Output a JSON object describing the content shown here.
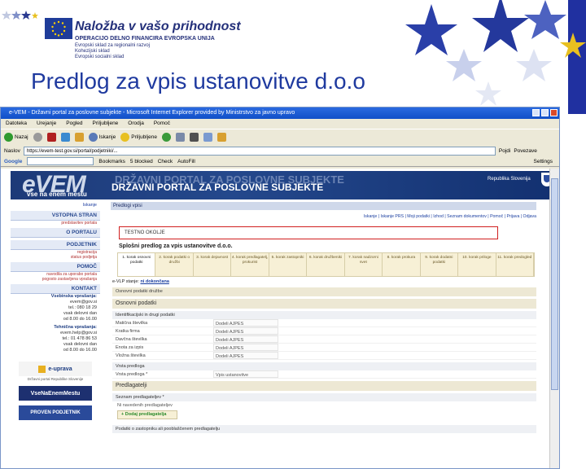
{
  "eu_header": {
    "title": "Naložba v vašo prihodnost",
    "subtitle": "OPERACIJO DELNO FINANCIRA EVROPSKA UNIJA",
    "fund_line_1": "Evropski sklad za regionalni razvoj",
    "fund_line_2": "Kohezijski sklad",
    "fund_line_3": "Evropski socialni sklad"
  },
  "slide_title": "Predlog za vpis ustanovitve d.o.o",
  "browser": {
    "window_title": "e-VEM - Državni portal za poslovne subjekte - Microsoft Internet Explorer provided by Ministrstvo za javno upravo",
    "menu": [
      "Datoteka",
      "Urejanje",
      "Pogled",
      "Priljubljene",
      "Orodja",
      "Pomoč"
    ],
    "toolbar": {
      "back_label": "Nazaj",
      "search_label": "Iskanje",
      "favorites_label": "Priljubljene"
    },
    "address_label": "Naslov",
    "address_value": "https://evem-test.gov.si/portal/podjetniki/...",
    "go_label": "Pojdi",
    "links_label": "Povezave",
    "google": {
      "brand": "Google",
      "buttons": [
        "Bookmarks",
        "5 blocked",
        "Check",
        "AutoFill"
      ],
      "settings_label": "Settings"
    }
  },
  "site": {
    "logo": "eVEM",
    "logo_sub": "vse na enem mestu",
    "portal_title": "DRŽAVNI PORTAL ZA POSLOVNE SUBJEKTE",
    "republic": "Republika Slovenija"
  },
  "sidebar": {
    "top_link": "Iskanje",
    "vstopna_head": "VSTOPNA STRAN",
    "vstopna_sub": "predstavitev portala",
    "o_portalu": "O PORTALU",
    "podjetnik_head": "PODJETNIK",
    "podjetnik_links": [
      "registracija",
      "status podjetja"
    ],
    "pomoc_head": "POMOČ",
    "pomoc_links": [
      "navodila za uporabo portala",
      "pogosto zastavljena vprašanja"
    ],
    "kontakt_head": "KONTAKT",
    "vsebinska_title": "Vsebinska vprašanja:",
    "vsebinska_lines": [
      "evem@gov.si",
      "tel.: 080 18 29",
      "vsak delovni dan",
      "od 8.00 do 16.00"
    ],
    "tehnicna_title": "Tehnična vprašanja:",
    "tehnicna_lines": [
      "evem.help@gov.si",
      "tel.: 01 478 86 53",
      "vsak delovni dan",
      "od 8.00 do 16.00"
    ],
    "banner_1": "e-uprava",
    "banner_1_sub": "Državni portal Republike Slovenije",
    "banner_2": "VseNaEnemMestu",
    "banner_3": "PROVEN PODJETNIK"
  },
  "content": {
    "crumb": "Predlogi vpisi",
    "top_links": "Iskanje | Iskanje PRS | Moji podatki | Izhod | Seznam dokumentov | Pomoč | Prijava | Odjava",
    "test_notice": "TESTNO OKOLJE",
    "form_title": "Splošni predlog za vpis ustanovitve d.o.o.",
    "steps": [
      "1. korak osnovni podatki",
      "2. korak podatki o družbi",
      "3. korak dejavnost",
      "4. korak predlagatelj, prokurist",
      "5. korak zastopniki",
      "6. korak družbeniki",
      "7. korak nadzorni svet",
      "8. korak prokura",
      "9. korak dodatni podatki",
      "10. korak priloge",
      "11. korak predogled"
    ],
    "eval_label": "e-VLP stanje:",
    "eval_link": "ni dokončana",
    "tab_bar": "Osnovni podatki družbe",
    "sec_osnovni": "Osnovni podatki",
    "sub_ident": "Identifikacijski in drugi podatki",
    "ident_rows": [
      {
        "label": "Matična številka",
        "value": "Dodeli AJPES"
      },
      {
        "label": "Kratka firma",
        "value": "Dodeli AJPES"
      },
      {
        "label": "Davčna številka",
        "value": "Dodeli AJPES"
      },
      {
        "label": "Enota za izpis",
        "value": "Dodeli AJPES"
      },
      {
        "label": "Vložna številka",
        "value": "Dodeli AJPES"
      }
    ],
    "sub_vrsta": "Vrsta predloga",
    "vrsta_row": {
      "label": "Vrsta predloga *",
      "value": "Vpis ustanovitve"
    },
    "sec_predlagatelji": "Predlagatelji",
    "sub_seznam": "Seznam predlagateljev *",
    "seznam_text": "Ni navedenih predlagateljev",
    "add_btn": "Dodaj predlagatelja",
    "sub_zastopnik": "Podatki o zastopniku ali pooblaščenem predlagatelju"
  },
  "colors": {
    "eu_blue": "#24307a",
    "title_blue": "#1f3a9f",
    "header_blue": "#1d3a78",
    "alert_red": "#d02020"
  }
}
